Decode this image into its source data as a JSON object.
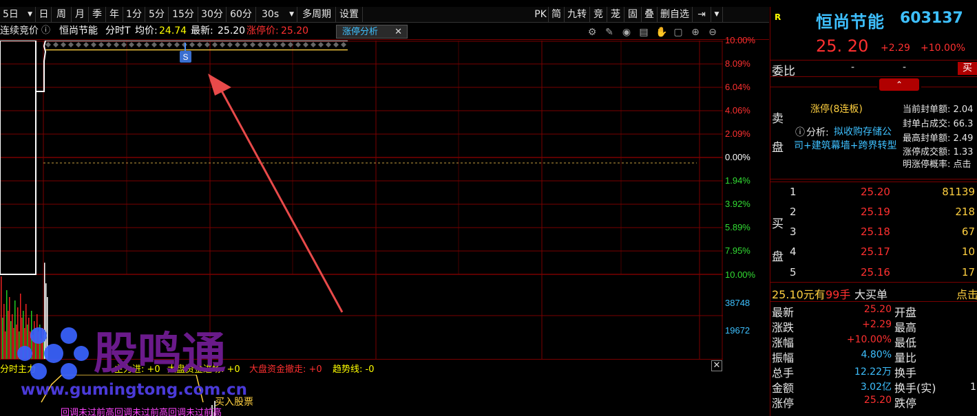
{
  "toolbar": {
    "period_select": "5日",
    "items": [
      "日",
      "周",
      "月",
      "季",
      "年",
      "1分",
      "5分",
      "15分",
      "30分",
      "60分",
      "30s",
      "多周期",
      "设置"
    ],
    "right_items": [
      "PK",
      "简",
      "九转",
      "竞",
      "茏",
      "固",
      "叠",
      "删自选"
    ]
  },
  "infobar": {
    "auction_label": "连续竞价",
    "stock_name": "恒尚节能",
    "chart_type": "分时T",
    "avg_label": "均价:",
    "avg_value": "24.74",
    "latest_label": "最新:",
    "latest_value": "25.20",
    "limit_label": "涨停价:",
    "limit_value": "25.20",
    "tab_label": "涨停分析"
  },
  "chart": {
    "upper_labels": [
      "10.00%",
      "8.09%",
      "6.04%",
      "4.06%",
      "2.09%",
      "0.00%",
      "1.94%",
      "3.92%",
      "5.89%",
      "7.95%",
      "10.00%"
    ],
    "volume_labels": [
      "38748",
      "19672"
    ],
    "marker_label": "S"
  },
  "chart_data": {
    "type": "line",
    "title": "",
    "ylim": [
      -10,
      10
    ],
    "series": [
      {
        "values": [
          10.0,
          10.0,
          10.0
        ]
      },
      {
        "values": [
          9.2,
          9.2,
          9.2
        ]
      }
    ]
  },
  "indicator": {
    "text1": "分时主力",
    "text2": "主力进: +0",
    "text3": "大盘资金进场: +0",
    "text4": "大盘资金撤走: +0",
    "text5": "趋势线: -0",
    "buy_label": "买入股票",
    "note_text": "回调未过前高回调未过前高回调未过前高"
  },
  "watermark": {
    "brand": "股鸣通",
    "url": "www.gumingtong.com.cn"
  },
  "quote": {
    "r_badge": "R",
    "name": "恒尚节能",
    "code": "603137",
    "price": "25. 20",
    "change": "+2.29",
    "change_pct": "+10.00%",
    "weibi_label": "委比",
    "weibi_v1": "-",
    "weibi_v2": "-",
    "buy_btn": "买",
    "sell_side_label": "卖盘",
    "limit_status": "涨停(8连板)",
    "analysis_prefix": "分析:",
    "analysis_text": "拟收购存储公司+建筑幕墙+跨界转型",
    "stats": [
      "当前封单额: 2.04",
      "封单占成交: 66.3",
      "最高封单额: 2.49",
      "涨停成交额: 1.33",
      "明涨停概率: 点击"
    ],
    "buy_side_label": "买盘",
    "bids": [
      {
        "level": "1",
        "price": "25.20",
        "vol": "81139"
      },
      {
        "level": "2",
        "price": "25.19",
        "vol": "218"
      },
      {
        "level": "3",
        "price": "25.18",
        "vol": "67"
      },
      {
        "level": "4",
        "price": "25.17",
        "vol": "10"
      },
      {
        "level": "5",
        "price": "25.16",
        "vol": "17"
      }
    ],
    "bigorder_price": "25.10元有",
    "bigorder_qty": "99手",
    "bigorder_label": "大买单",
    "bigorder_click": "点击",
    "fields": [
      {
        "label": "最新",
        "value": "25.20",
        "label2": "开盘"
      },
      {
        "label": "涨跌",
        "value": "+2.29",
        "label2": "最高"
      },
      {
        "label": "涨幅",
        "value": "+10.00%",
        "label2": "最低"
      },
      {
        "label": "振幅",
        "value": "4.80%",
        "label2": "量比"
      },
      {
        "label": "总手",
        "value": "12.22万",
        "label2": "换手"
      },
      {
        "label": "金额",
        "value": "3.02亿",
        "label2": "换手(实)"
      },
      {
        "label": "涨停",
        "value": "25.20",
        "label2": "跌停"
      }
    ],
    "trailing_one": "1"
  },
  "colors": {
    "red": "#ff3030",
    "green": "#33dd33",
    "yellow": "#ffff00",
    "cyan": "#3ec0ff",
    "grid": "#7a0000"
  }
}
